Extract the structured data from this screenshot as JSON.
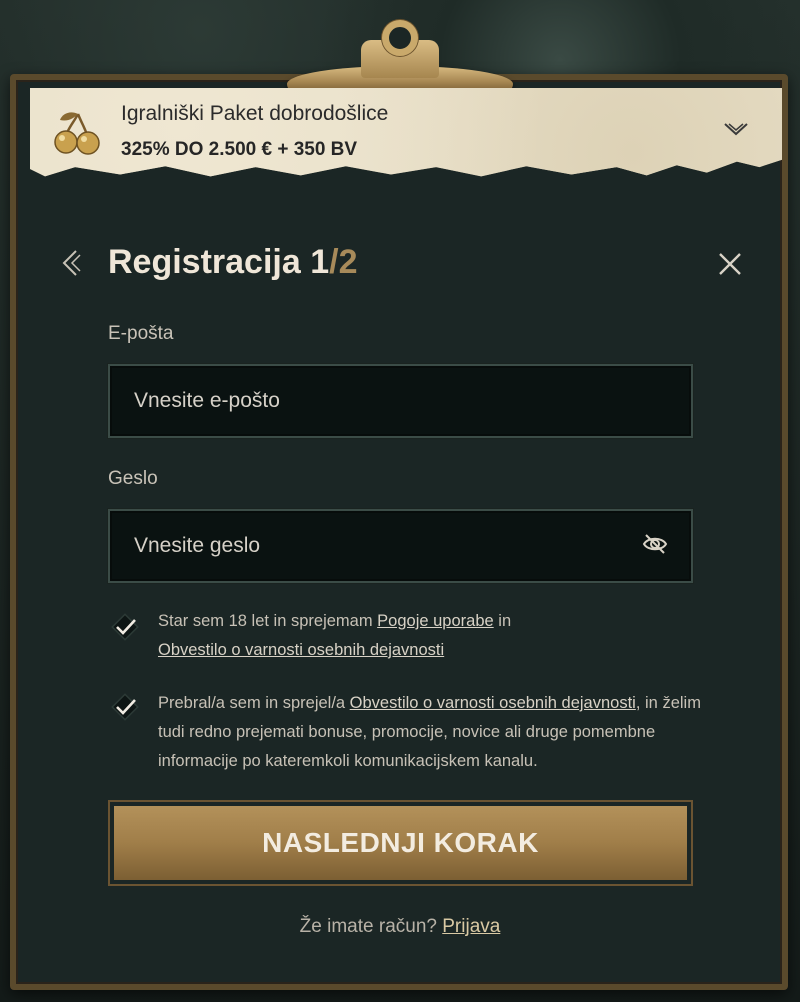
{
  "promo": {
    "title": "Igralniški Paket dobrodošlice",
    "subtitle": "325% DO 2.500 € + 350 BV",
    "icon": "cherry-icon"
  },
  "header": {
    "title_prefix": "Registracija 1",
    "title_suffix": "/2",
    "back_icon": "chevron-left-icon",
    "close_icon": "close-icon"
  },
  "email": {
    "label": "E-pošta",
    "placeholder": "Vnesite e-pošto",
    "value": ""
  },
  "password": {
    "label": "Geslo",
    "placeholder": "Vnesite geslo",
    "value": "",
    "toggle_icon": "eye-off-icon"
  },
  "consents": [
    {
      "checked": true,
      "text_before": "Star sem 18 let in sprejemam ",
      "link1": "Pogoje uporabe",
      "text_middle": " in ",
      "link2": "Obvestilo o varnosti osebnih dejavnosti",
      "text_after": ""
    },
    {
      "checked": true,
      "text_before": "Prebral/a sem in sprejel/a ",
      "link1": "Obvestilo o varnosti osebnih dejavnosti",
      "text_after": ", in želim tudi redno prejemati bonuse, promocije, novice ali druge pomembne informacije po kateremkoli komunikacijskem kanalu."
    }
  ],
  "next_button": {
    "label": "NASLEDNJI KORAK"
  },
  "login": {
    "question": "Že imate račun?",
    "link": "Prijava"
  },
  "colors": {
    "board": "#1b2625",
    "gold": "#a78a5a",
    "text": "#efe6d8"
  }
}
